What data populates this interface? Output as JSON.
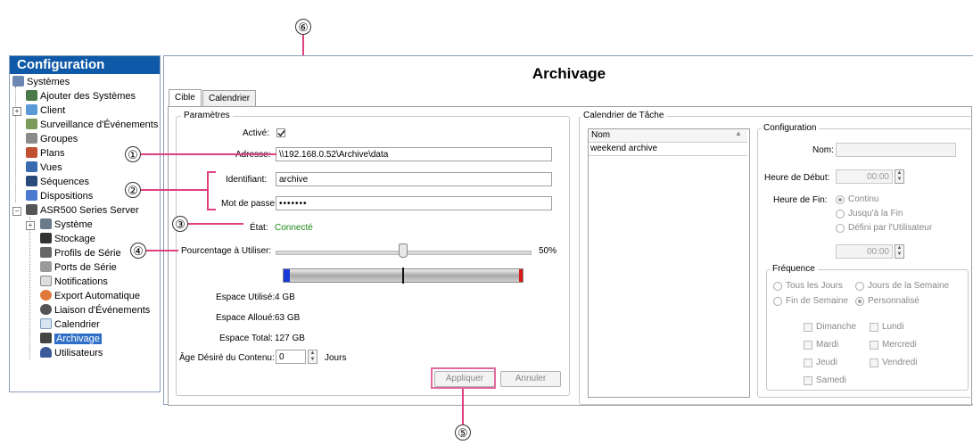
{
  "sidebar": {
    "title": "Configuration",
    "items": [
      {
        "label": "Systèmes",
        "icon": "systems-icon"
      },
      {
        "label": "Ajouter des Systèmes",
        "icon": "add-system-icon"
      },
      {
        "label": "Client",
        "icon": "client-icon"
      },
      {
        "label": "Surveillance d'Événements",
        "icon": "event-monitor-icon"
      },
      {
        "label": "Groupes",
        "icon": "groups-icon"
      },
      {
        "label": "Plans",
        "icon": "maps-icon"
      },
      {
        "label": "Vues",
        "icon": "views-icon"
      },
      {
        "label": "Séquences",
        "icon": "sequences-icon"
      },
      {
        "label": "Dispositions",
        "icon": "layouts-icon"
      },
      {
        "label": "ASR500 Series Server",
        "icon": "server-icon"
      },
      {
        "label": "Système",
        "icon": "system-icon"
      },
      {
        "label": "Stockage",
        "icon": "storage-icon"
      },
      {
        "label": "Profils de Série",
        "icon": "serial-profiles-icon"
      },
      {
        "label": "Ports de Série",
        "icon": "serial-ports-icon"
      },
      {
        "label": "Notifications",
        "icon": "notifications-icon"
      },
      {
        "label": "Export Automatique",
        "icon": "auto-export-icon"
      },
      {
        "label": "Liaison d'Événements",
        "icon": "event-link-icon"
      },
      {
        "label": "Calendrier",
        "icon": "calendar-icon"
      },
      {
        "label": "Archivage",
        "icon": "archive-icon"
      },
      {
        "label": "Utilisateurs",
        "icon": "users-icon"
      }
    ]
  },
  "main": {
    "title": "Archivage",
    "tabs": [
      {
        "label": "Cible"
      },
      {
        "label": "Calendrier"
      }
    ]
  },
  "params": {
    "group_title": "Paramètres",
    "active_label": "Activé:",
    "address_label": "Adresse:",
    "address_value": "\\\\192.168.0.52\\Archive\\data",
    "id_label": "Identifiant:",
    "id_value": "archive",
    "password_label": "Mot de passe:",
    "password_value": "•••••••",
    "state_label": "État:",
    "state_value": "Connecté",
    "percent_label": "Pourcentage à Utiliser:",
    "percent_value": "50%",
    "percent_fraction": 0.5,
    "used_label": "Espace Utilisé:",
    "used_value": "4 GB",
    "alloc_label": "Espace Alloué:",
    "alloc_value": "63 GB",
    "total_label": "Espace Total:",
    "total_value": "127 GB",
    "age_label": "Âge Désiré du Contenu:",
    "age_value": "0",
    "age_unit": "Jours",
    "apply_label": "Appliquer",
    "cancel_label": "Annuler"
  },
  "schedule": {
    "group_title": "Calendrier de Tâche",
    "list_header": "Nom",
    "items": [
      "weekend archive"
    ],
    "config_title": "Configuration",
    "name_label": "Nom:",
    "start_label": "Heure de Début:",
    "start_value": "00:00",
    "end_label": "Heure de Fin:",
    "end_options": [
      "Continu",
      "Jusqu'à la Fin",
      "Défini par l'Utilisateur"
    ],
    "end_value": "00:00",
    "freq_title": "Fréquence",
    "freq_options": [
      "Tous les Jours",
      "Jours de la Semaine",
      "Fin de Semaine",
      "Personnalisé"
    ],
    "days": [
      "Dimanche",
      "Lundi",
      "Mardi",
      "Mercredi",
      "Jeudi",
      "Vendredi",
      "Samedi"
    ]
  },
  "callouts": [
    "①",
    "②",
    "③",
    "④",
    "⑤",
    "⑥"
  ],
  "colors": {
    "accent": "#0f5aa8",
    "callout_line": "#e0407f",
    "connected": "#1a8a1a"
  }
}
